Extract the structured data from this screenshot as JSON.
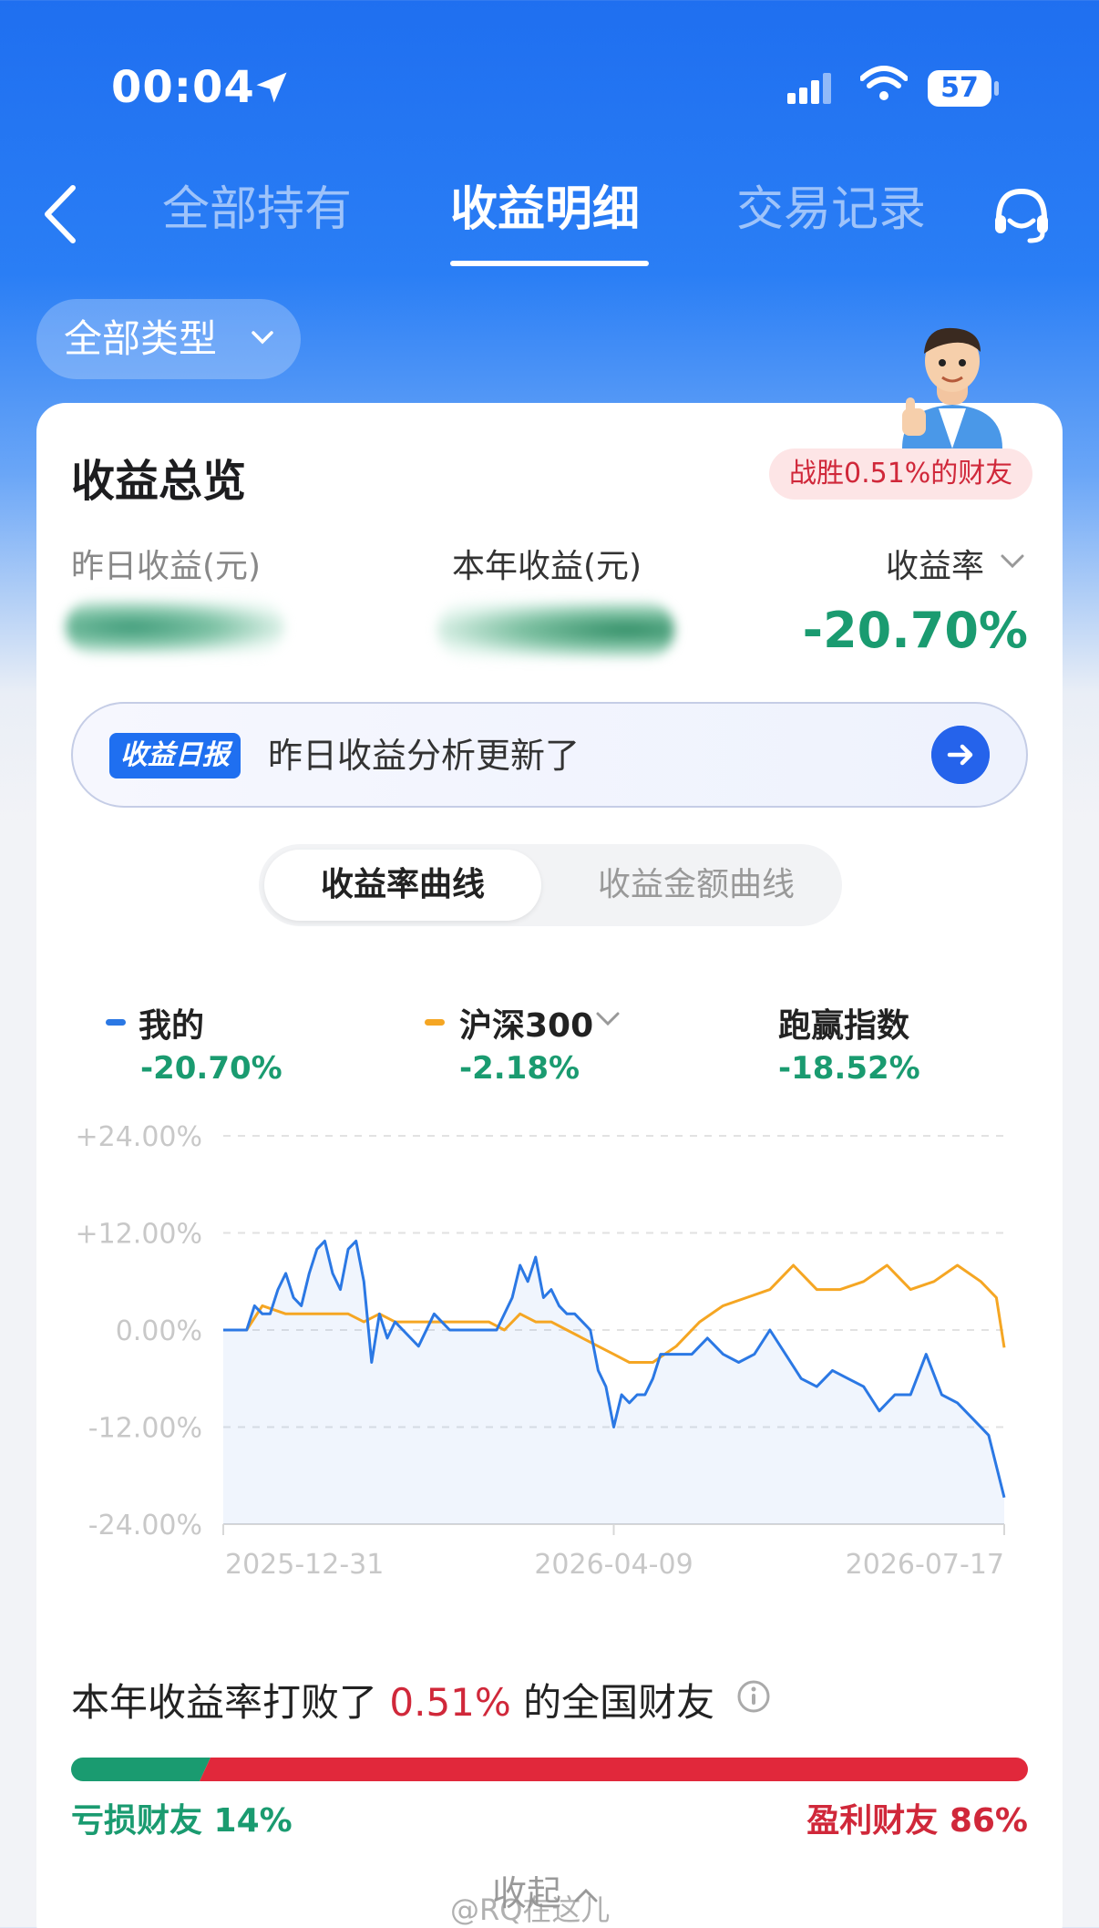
{
  "status_bar": {
    "time": "00:04",
    "battery": "57"
  },
  "nav": {
    "tabs": [
      {
        "label": "全部持有",
        "active": false
      },
      {
        "label": "收益明细",
        "active": true
      },
      {
        "label": "交易记录",
        "active": false
      }
    ]
  },
  "filter": {
    "label": "全部类型"
  },
  "overview": {
    "title": "收益总览",
    "beat_badge": "战胜0.51%的财友",
    "yesterday_label": "昨日收益(元)",
    "year_label": "本年收益(元)",
    "rate_label": "收益率",
    "rate_value": "-20.70%"
  },
  "daily_report": {
    "tag": "收益日报",
    "text": "昨日收益分析更新了"
  },
  "segment": {
    "active": "收益率曲线",
    "inactive": "收益金额曲线"
  },
  "legend": [
    {
      "name": "我的",
      "value": "-20.70%",
      "color": "#2b78e4"
    },
    {
      "name": "沪深300",
      "value": "-2.18%",
      "color": "#f5a623"
    },
    {
      "name": "跑赢指数",
      "value": "-18.52%"
    }
  ],
  "chart_data": {
    "type": "line",
    "y_ticks": [
      "+24.00%",
      "+12.00%",
      "0.00%",
      "-12.00%",
      "-24.00%"
    ],
    "ylim": [
      -24,
      24
    ],
    "x_ticks": [
      "2025-12-31",
      "2026-04-09",
      "2026-07-17"
    ],
    "series": [
      {
        "name": "我的",
        "color": "#2b78e4",
        "x": [
          0,
          3,
          4,
          5,
          6,
          7,
          8,
          9,
          10,
          11,
          12,
          13,
          14,
          15,
          16,
          17,
          18,
          19,
          20,
          21,
          22,
          23,
          25,
          27,
          29,
          31,
          33,
          35,
          37,
          38,
          39,
          40,
          41,
          42,
          43,
          44,
          45,
          46,
          47,
          48,
          49,
          50,
          51,
          52,
          53,
          54,
          55,
          56,
          58,
          60,
          62,
          64,
          66,
          68,
          70,
          72,
          74,
          76,
          78,
          80,
          82,
          84,
          86,
          88,
          90,
          92,
          94,
          96,
          98,
          100
        ],
        "y": [
          0,
          0,
          3,
          2,
          2,
          5,
          7,
          4,
          3,
          7,
          10,
          11,
          7,
          5,
          10,
          11,
          6,
          -4,
          2,
          -1,
          1,
          0,
          -2,
          2,
          0,
          0,
          0,
          0,
          4,
          8,
          6,
          9,
          4,
          5,
          3,
          2,
          2,
          1,
          0,
          -5,
          -7,
          -12,
          -8,
          -9,
          -8,
          -8,
          -6,
          -3,
          -3,
          -3,
          -1,
          -3,
          -4,
          -3,
          0,
          -3,
          -6,
          -7,
          -5,
          -6,
          -7,
          -10,
          -8,
          -8,
          -3,
          -8,
          -9,
          -11,
          -13,
          -20.7
        ]
      },
      {
        "name": "沪深300",
        "color": "#f5a623",
        "x": [
          0,
          3,
          5,
          8,
          12,
          16,
          18,
          20,
          22,
          25,
          28,
          31,
          34,
          36,
          38,
          40,
          42,
          44,
          46,
          48,
          50,
          52,
          55,
          58,
          61,
          64,
          67,
          70,
          73,
          76,
          79,
          82,
          85,
          88,
          91,
          94,
          97,
          99,
          100
        ],
        "y": [
          0,
          0,
          3,
          2,
          2,
          2,
          1,
          2,
          1,
          1,
          1,
          1,
          1,
          0,
          2,
          1,
          1,
          0,
          -1,
          -2,
          -3,
          -4,
          -4,
          -2,
          1,
          3,
          4,
          5,
          8,
          5,
          5,
          6,
          8,
          5,
          6,
          8,
          6,
          4,
          -2.18
        ]
      }
    ]
  },
  "beat_rank": {
    "prefix": "本年收益率打败了",
    "percent": "0.51%",
    "suffix": "的全国财友"
  },
  "distribution": {
    "loss_label": "亏损财友 14%",
    "profit_label": "盈利财友 86%",
    "loss_share": 0.14,
    "profit_share": 0.86
  },
  "collapse_label": "收起",
  "watermark": "@RQ在这儿"
}
